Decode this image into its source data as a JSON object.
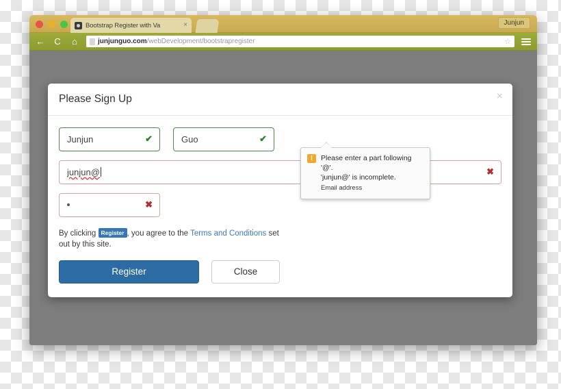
{
  "browser": {
    "tab": {
      "title": "Bootstrap Register with Va",
      "favicon": "camera-icon",
      "close": "×"
    },
    "user_chip": "Junjun",
    "toolbar": {
      "back": "←",
      "reload": "C",
      "home": "⌂",
      "star": "☆",
      "url_domain": "junjunguo.com",
      "url_path": "/webDevelopment/bootstrapregister"
    }
  },
  "page": {
    "register_button": "register"
  },
  "modal": {
    "title": "Please Sign Up",
    "close": "×",
    "fields": {
      "first_name": {
        "value": "Junjun",
        "state": "valid",
        "mark": "✔"
      },
      "last_name": {
        "value": "Guo",
        "state": "valid",
        "mark": "✔"
      },
      "email": {
        "value": "junjun@",
        "state": "invalid",
        "mark": "✖"
      },
      "password": {
        "value": "•",
        "state": "invalid",
        "mark": "✖"
      }
    },
    "tooltip": {
      "icon": "!",
      "line1": "Please enter a part following '@'.",
      "line2": "'junjun@' is incomplete.",
      "sub": "Email address"
    },
    "terms": {
      "prefix": "By clicking",
      "badge": "Register",
      "middle": ", you agree to the",
      "link": "Terms and Conditions",
      "suffix": "set out by this site."
    },
    "buttons": {
      "register": "Register",
      "close": "Close"
    }
  },
  "colors": {
    "accent_blue": "#2d6ca2",
    "link_blue": "#3a7bbf",
    "valid_green": "#4b8b4b",
    "invalid_red": "#d9a2a2",
    "error_mark": "#b03030",
    "warning_orange": "#f0a830",
    "overlay_gray": "#7d7d7d",
    "tab_gold": "#c9a94e",
    "toolbar_green": "#8d9c31"
  }
}
